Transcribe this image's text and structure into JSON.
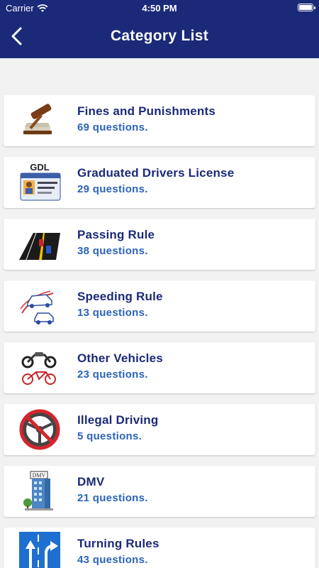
{
  "status": {
    "carrier": "Carrier",
    "time": "4:50 PM"
  },
  "nav": {
    "title": "Category List"
  },
  "categories": [
    {
      "name": "Fines and Punishments",
      "count": "69 questions.",
      "icon": "gavel-icon"
    },
    {
      "name": "Graduated Drivers License",
      "count": "29 questions.",
      "icon": "drivers-license-icon",
      "icon_text": "GDL"
    },
    {
      "name": "Passing Rule",
      "count": "38 questions.",
      "icon": "road-passing-icon"
    },
    {
      "name": "Speeding Rule",
      "count": "13 questions.",
      "icon": "speeding-cars-icon"
    },
    {
      "name": "Other Vehicles",
      "count": "23 questions.",
      "icon": "motorcycle-bicycle-icon"
    },
    {
      "name": "Illegal Driving",
      "count": "5 questions.",
      "icon": "no-driving-icon"
    },
    {
      "name": "DMV",
      "count": "21 questions.",
      "icon": "dmv-building-icon",
      "icon_text": "DMV"
    },
    {
      "name": "Turning Rules",
      "count": "43 questions.",
      "icon": "turn-arrows-icon"
    }
  ],
  "colors": {
    "nav_bg": "#1b2a78",
    "name_text": "#1b2a78",
    "count_text": "#2a64b8",
    "background": "#f2f2f2"
  }
}
